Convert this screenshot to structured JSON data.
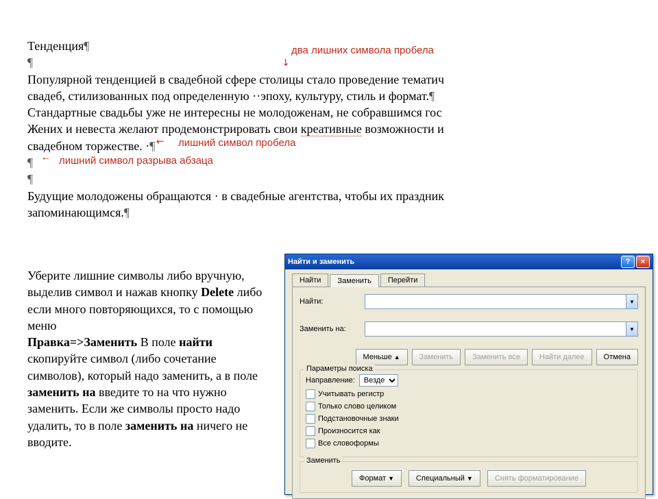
{
  "doc": {
    "heading": "Тенденция",
    "p1_a": "Популярной тенденцией в свадебной сфере ",
    "p1_b": "столицы стало проведение тематич",
    "p2": "свадеб, стилизованных под определенную ··эпоху, культуру, стиль и формат.",
    "p3": "Стандартные свадьбы уже не интересны не молодоженам, не собравшимся гос",
    "p4_a": "Жених и невеста желают продемонстрировать свои ",
    "p4_kw": "креативные",
    "p4_b": " возможности и",
    "p5": "свадебном торжестве. ·",
    "p6": "Будущие молодожены обращаются · в свадебные агентства, чтобы их праздник",
    "p7": "запоминающимся."
  },
  "callouts": {
    "c1": "два лишних символа пробела",
    "c2": "лишний символ пробела",
    "c3": "лишний символ разрыва абзаца"
  },
  "instr": {
    "t1": "Уберите лишние символы либо вручную, выделив символ и нажав кнопку ",
    "kw_delete": "Delete",
    "t2": " либо если много повторяющихся, то с помощью меню",
    "kw_path": "Правка=>Заменить",
    "t3": " В поле ",
    "kw_find": "найти",
    "t4": " скопируйте символ (либо сочетание символов), который надо заменить, а в поле ",
    "kw_replace": "заменить на",
    "t5": " введите то на что нужно заменить. Если же символы просто надо удалить, то в поле ",
    "kw_replace2": "заменить на",
    "t6": " ничего не вводите."
  },
  "dialog": {
    "title": "Найти и заменить",
    "tabs": {
      "find": "Найти",
      "replace": "Заменить",
      "goto": "Перейти"
    },
    "labels": {
      "find": "Найти:",
      "replace": "Заменить на:"
    },
    "buttons": {
      "less": "Меньше",
      "replace": "Заменить",
      "replace_all": "Заменить все",
      "find_next": "Найти далее",
      "cancel": "Отмена",
      "format": "Формат",
      "special": "Специальный",
      "unformat": "Снять форматирование"
    },
    "group_search": "Параметры поиска",
    "direction_label": "Направление:",
    "direction_value": "Везде",
    "checks": {
      "case": "Учитывать регистр",
      "whole": "Только слово целиком",
      "wildcard": "Подстановочные знаки",
      "sounds": "Произносится как",
      "forms": "Все словоформы"
    },
    "group_replace": "Заменить"
  }
}
